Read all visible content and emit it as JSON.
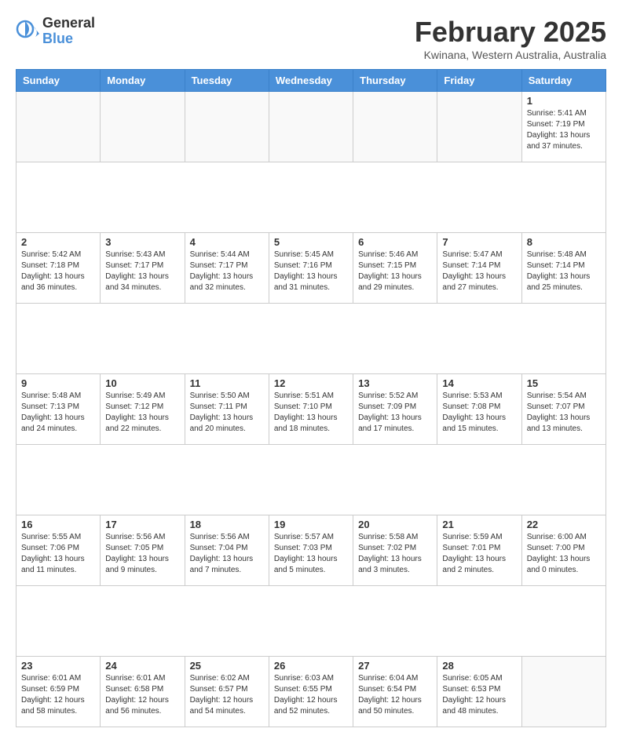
{
  "header": {
    "logo_general": "General",
    "logo_blue": "Blue",
    "title": "February 2025",
    "location": "Kwinana, Western Australia, Australia"
  },
  "weekdays": [
    "Sunday",
    "Monday",
    "Tuesday",
    "Wednesday",
    "Thursday",
    "Friday",
    "Saturday"
  ],
  "weeks": [
    [
      {
        "day": "",
        "info": ""
      },
      {
        "day": "",
        "info": ""
      },
      {
        "day": "",
        "info": ""
      },
      {
        "day": "",
        "info": ""
      },
      {
        "day": "",
        "info": ""
      },
      {
        "day": "",
        "info": ""
      },
      {
        "day": "1",
        "info": "Sunrise: 5:41 AM\nSunset: 7:19 PM\nDaylight: 13 hours\nand 37 minutes."
      }
    ],
    [
      {
        "day": "2",
        "info": "Sunrise: 5:42 AM\nSunset: 7:18 PM\nDaylight: 13 hours\nand 36 minutes."
      },
      {
        "day": "3",
        "info": "Sunrise: 5:43 AM\nSunset: 7:17 PM\nDaylight: 13 hours\nand 34 minutes."
      },
      {
        "day": "4",
        "info": "Sunrise: 5:44 AM\nSunset: 7:17 PM\nDaylight: 13 hours\nand 32 minutes."
      },
      {
        "day": "5",
        "info": "Sunrise: 5:45 AM\nSunset: 7:16 PM\nDaylight: 13 hours\nand 31 minutes."
      },
      {
        "day": "6",
        "info": "Sunrise: 5:46 AM\nSunset: 7:15 PM\nDaylight: 13 hours\nand 29 minutes."
      },
      {
        "day": "7",
        "info": "Sunrise: 5:47 AM\nSunset: 7:14 PM\nDaylight: 13 hours\nand 27 minutes."
      },
      {
        "day": "8",
        "info": "Sunrise: 5:48 AM\nSunset: 7:14 PM\nDaylight: 13 hours\nand 25 minutes."
      }
    ],
    [
      {
        "day": "9",
        "info": "Sunrise: 5:48 AM\nSunset: 7:13 PM\nDaylight: 13 hours\nand 24 minutes."
      },
      {
        "day": "10",
        "info": "Sunrise: 5:49 AM\nSunset: 7:12 PM\nDaylight: 13 hours\nand 22 minutes."
      },
      {
        "day": "11",
        "info": "Sunrise: 5:50 AM\nSunset: 7:11 PM\nDaylight: 13 hours\nand 20 minutes."
      },
      {
        "day": "12",
        "info": "Sunrise: 5:51 AM\nSunset: 7:10 PM\nDaylight: 13 hours\nand 18 minutes."
      },
      {
        "day": "13",
        "info": "Sunrise: 5:52 AM\nSunset: 7:09 PM\nDaylight: 13 hours\nand 17 minutes."
      },
      {
        "day": "14",
        "info": "Sunrise: 5:53 AM\nSunset: 7:08 PM\nDaylight: 13 hours\nand 15 minutes."
      },
      {
        "day": "15",
        "info": "Sunrise: 5:54 AM\nSunset: 7:07 PM\nDaylight: 13 hours\nand 13 minutes."
      }
    ],
    [
      {
        "day": "16",
        "info": "Sunrise: 5:55 AM\nSunset: 7:06 PM\nDaylight: 13 hours\nand 11 minutes."
      },
      {
        "day": "17",
        "info": "Sunrise: 5:56 AM\nSunset: 7:05 PM\nDaylight: 13 hours\nand 9 minutes."
      },
      {
        "day": "18",
        "info": "Sunrise: 5:56 AM\nSunset: 7:04 PM\nDaylight: 13 hours\nand 7 minutes."
      },
      {
        "day": "19",
        "info": "Sunrise: 5:57 AM\nSunset: 7:03 PM\nDaylight: 13 hours\nand 5 minutes."
      },
      {
        "day": "20",
        "info": "Sunrise: 5:58 AM\nSunset: 7:02 PM\nDaylight: 13 hours\nand 3 minutes."
      },
      {
        "day": "21",
        "info": "Sunrise: 5:59 AM\nSunset: 7:01 PM\nDaylight: 13 hours\nand 2 minutes."
      },
      {
        "day": "22",
        "info": "Sunrise: 6:00 AM\nSunset: 7:00 PM\nDaylight: 13 hours\nand 0 minutes."
      }
    ],
    [
      {
        "day": "23",
        "info": "Sunrise: 6:01 AM\nSunset: 6:59 PM\nDaylight: 12 hours\nand 58 minutes."
      },
      {
        "day": "24",
        "info": "Sunrise: 6:01 AM\nSunset: 6:58 PM\nDaylight: 12 hours\nand 56 minutes."
      },
      {
        "day": "25",
        "info": "Sunrise: 6:02 AM\nSunset: 6:57 PM\nDaylight: 12 hours\nand 54 minutes."
      },
      {
        "day": "26",
        "info": "Sunrise: 6:03 AM\nSunset: 6:55 PM\nDaylight: 12 hours\nand 52 minutes."
      },
      {
        "day": "27",
        "info": "Sunrise: 6:04 AM\nSunset: 6:54 PM\nDaylight: 12 hours\nand 50 minutes."
      },
      {
        "day": "28",
        "info": "Sunrise: 6:05 AM\nSunset: 6:53 PM\nDaylight: 12 hours\nand 48 minutes."
      },
      {
        "day": "",
        "info": ""
      }
    ]
  ]
}
